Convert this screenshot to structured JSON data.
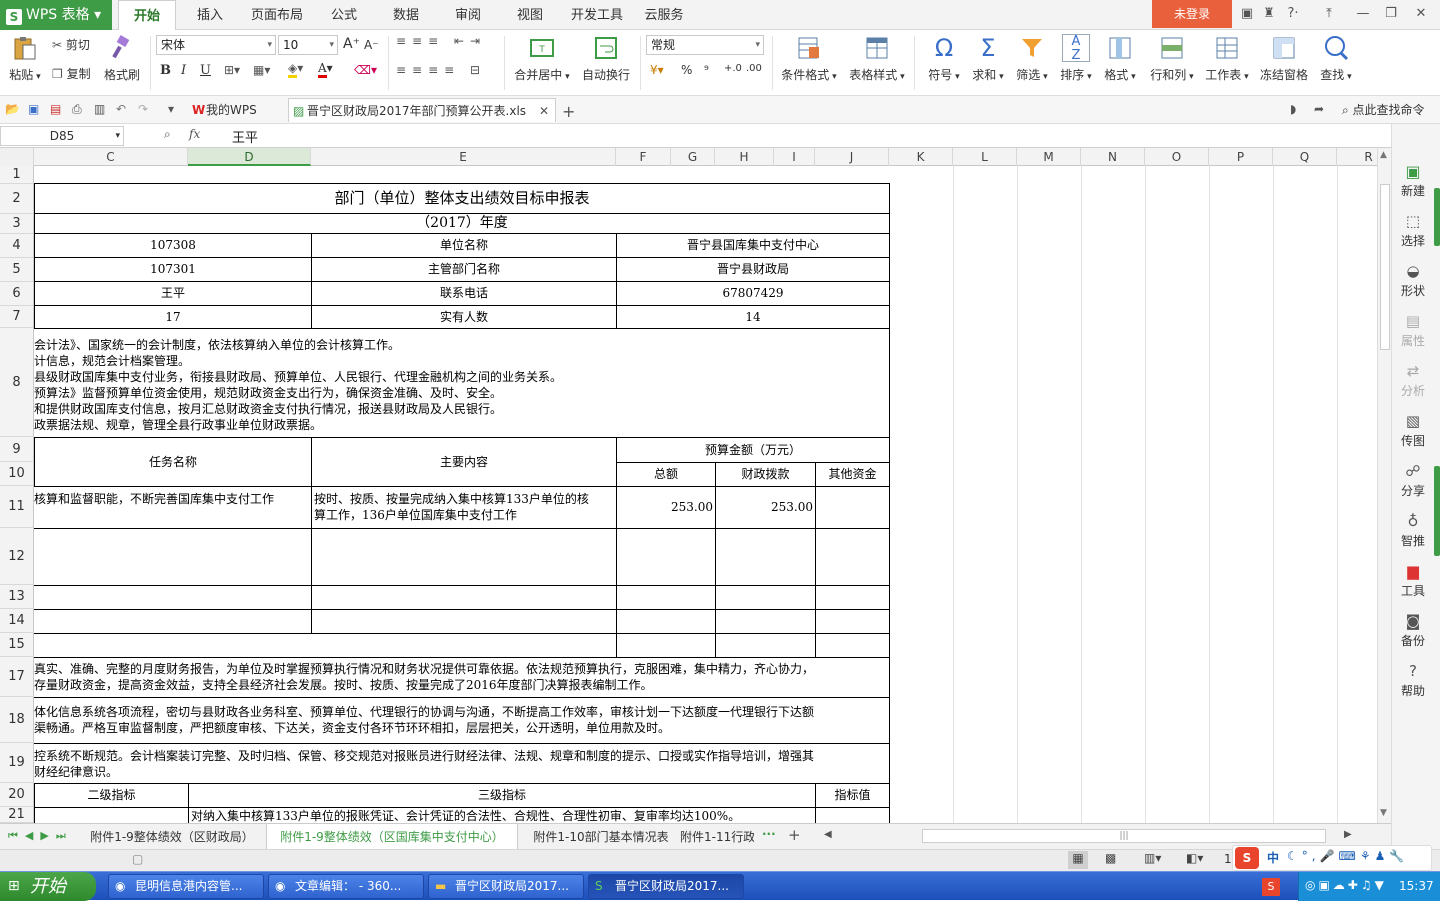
{
  "app": {
    "logo": "WPS 表格",
    "login": "未登录"
  },
  "menu": [
    "开始",
    "插入",
    "页面布局",
    "公式",
    "数据",
    "审阅",
    "视图",
    "开发工具",
    "云服务"
  ],
  "ribbon": {
    "paste": "粘贴",
    "cut": "剪切",
    "copy": "复制",
    "format_painter": "格式刷",
    "font": "宋体",
    "font_size": "10",
    "number_format": "常规",
    "merge": "合并居中",
    "wrap": "自动换行",
    "cond_format": "条件格式",
    "table_style": "表格样式",
    "symbol": "符号",
    "sum": "求和",
    "filter": "筛选",
    "sort": "排序",
    "format": "格式",
    "rowcol": "行和列",
    "worksheet": "工作表",
    "freeze": "冻结窗格",
    "find": "查找",
    "percent": "%",
    "thousands": "⁹",
    "inc_dec": ".00",
    "bold": "B",
    "italic": "I",
    "underline": "U"
  },
  "doc_tabs": {
    "mywps": "我的WPS",
    "file": "晋宁区财政局2017年部门预算公开表.xls",
    "cmd_search": "点此查找命令"
  },
  "formula": {
    "name_box": "D85",
    "fx": "fx",
    "value": "王平"
  },
  "columns": [
    "C",
    "D",
    "E",
    "F",
    "G",
    "H",
    "I",
    "J",
    "K",
    "L",
    "M",
    "N",
    "O",
    "P",
    "Q",
    "R"
  ],
  "rows": [
    "1",
    "2",
    "3",
    "4",
    "5",
    "6",
    "7",
    "8",
    "9",
    "10",
    "11",
    "12",
    "13",
    "14",
    "15",
    "17",
    "18",
    "19",
    "20",
    "21"
  ],
  "sheet": {
    "title": "部门（单位）整体支出绩效目标申报表",
    "year": "（2017）年度",
    "r4c": "107308",
    "r4e": "单位名称",
    "r4f": "晋宁县国库集中支付中心",
    "r5c": "107301",
    "r5e": "主管部门名称",
    "r5f": "晋宁县财政局",
    "r6c": "王平",
    "r6e": "联系电话",
    "r6f": "67807429",
    "r7c": "17",
    "r7e": "实有人数",
    "r7f": "14",
    "r8": [
      "会计法》、国家统一的会计制度，依法核算纳入单位的会计核算工作。",
      "计信息，规范会计档案管理。",
      "县级财政国库集中支付业务，衔接县财政局、预算单位、人民银行、代理金融机构之间的业务关系。",
      "预算法》监督预算单位资金使用，规范财政资金支出行为，确保资金准确、及时、安全。",
      "和提供财政国库支付信息，按月汇总财政资金支付执行情况，报送县财政局及人民银行。",
      "政票据法规、规章，管理全县行政事业单位财政票据。"
    ],
    "budget_hdr": "预算金额（万元）",
    "task_name": "任务名称",
    "main_content": "主要内容",
    "total": "总额",
    "fiscal": "财政拨款",
    "other": "其他资金",
    "r11c": "核算和监督职能，不断完善国库集中支付工作",
    "r11e1": "按时、按质、按量完成纳入集中核算133户单位的核",
    "r11e2": "算工作，136户单位国库集中支付工作",
    "r11f": "253.00",
    "r11h": "253.00",
    "r17": [
      "真实、准确、完整的月度财务报告，为单位及时掌握预算执行情况和财务状况提供可靠依据。依法规范预算执行，克服困难，集中精力，齐心协力，",
      "存量财政资金，提高资金效益，支持全县经济社会发展。按时、按质、按量完成了2016年度部门决算报表编制工作。"
    ],
    "r18": [
      "体化信息系统各项流程，密切与县财政各业务科室、预算单位、代理银行的协调与沟通，不断提高工作效率，审核计划一下达额度一代理银行下达额",
      "渠畅通。严格互审监督制度，严把额度审核、下达关，资金支付各环节环环相扣，层层把关，公开透明，单位用款及时。"
    ],
    "r19": [
      "控系统不断规范。会计档案装订完整、及时归档、保管、移交规范对报账员进行财经法律、法规、规章和制度的提示、口授或实作指导培训，增强其",
      "财经纪律意识。"
    ],
    "level2": "二级指标",
    "level3": "三级指标",
    "indicator": "指标值",
    "r21": "对纳入集中核算133户单位的报账凭证、会计凭证的合法性、合规性、合理性初审、复审率均达100%。"
  },
  "right_panel": [
    "新建",
    "选择",
    "形状",
    "属性",
    "分析",
    "传图",
    "分享",
    "智推",
    "工具",
    "备份",
    "帮助"
  ],
  "sheet_tabs": [
    "附件1-9整体绩效（区财政局）",
    "附件1-9整体绩效（区国库集中支付中心）",
    "附件1-10部门基本情况表",
    "附件1-11行政"
  ],
  "status": {
    "zoom": "10"
  },
  "taskbar": {
    "start": "开始",
    "items": [
      "昆明信息港内容管...",
      "文章编辑： - 360...",
      "晋宁区财政局2017...",
      "晋宁区财政局2017..."
    ],
    "ime": "中",
    "time": "15:37"
  }
}
